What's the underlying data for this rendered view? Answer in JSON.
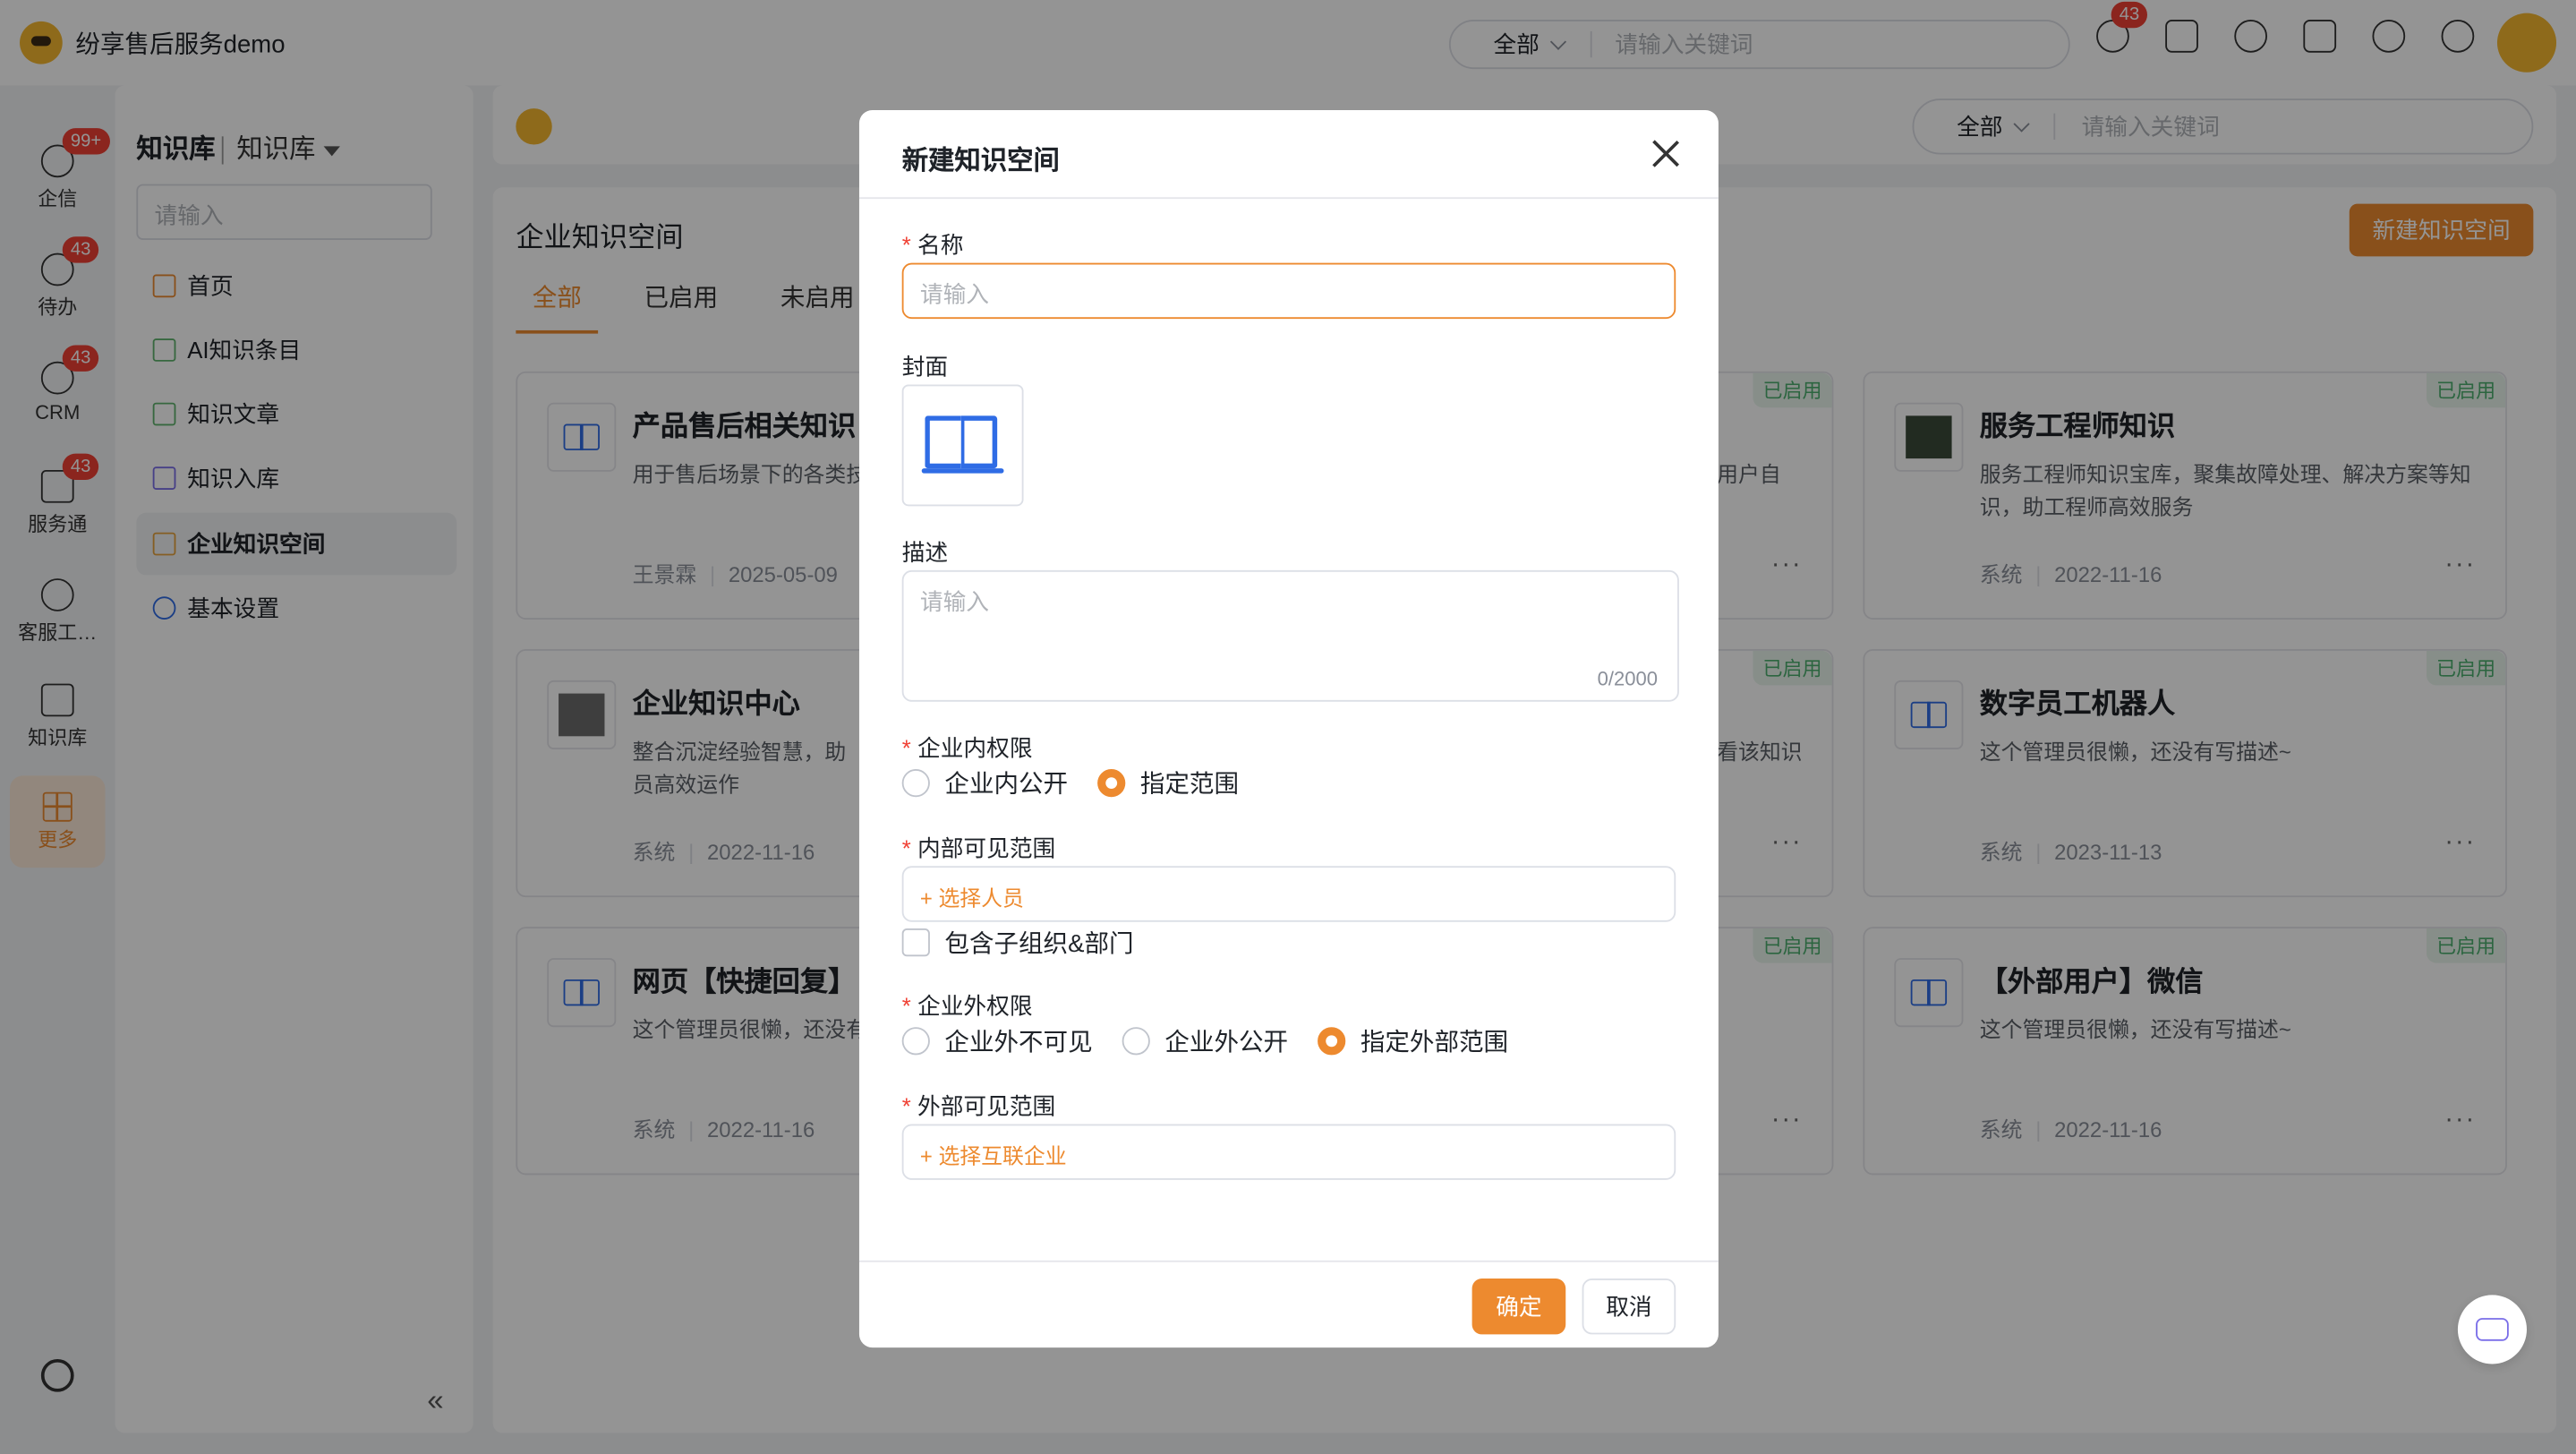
{
  "app": {
    "title": "纷享售后服务demo"
  },
  "top_search": {
    "scope": "全部",
    "placeholder": "请输入关键词"
  },
  "top_icons": {
    "notify_badge": "43"
  },
  "rail": {
    "items": [
      {
        "label": "企信",
        "badge": "99+"
      },
      {
        "label": "待办",
        "badge": "43"
      },
      {
        "label": "CRM",
        "badge": "43"
      },
      {
        "label": "服务通",
        "badge": "43"
      },
      {
        "label": "客服工…",
        "badge": ""
      },
      {
        "label": "知识库",
        "badge": ""
      }
    ],
    "more_label": "更多"
  },
  "sidebar": {
    "title": "知识库",
    "subtitle": "知识库",
    "search_placeholder": "请输入",
    "items": [
      {
        "label": "首页"
      },
      {
        "label": "AI知识条目"
      },
      {
        "label": "知识文章"
      },
      {
        "label": "知识入库"
      },
      {
        "label": "企业知识空间"
      },
      {
        "label": "基本设置"
      }
    ],
    "collapse_label": "«"
  },
  "main": {
    "search": {
      "scope": "全部",
      "placeholder": "请输入关键词"
    },
    "title": "企业知识空间",
    "new_button": "新建知识空间",
    "tabs": [
      {
        "label": "全部"
      },
      {
        "label": "已启用"
      },
      {
        "label": "未启用"
      }
    ],
    "cards": [
      {
        "title": "产品售后相关知识",
        "desc": "用于售后场景下的各类技",
        "author": "王景霖",
        "date": "2025-05-09",
        "tag": "已启用",
        "more": "···"
      },
      {
        "title": "",
        "desc": "用户自",
        "author": "",
        "date": "",
        "tag": "已启用",
        "more": "···"
      },
      {
        "title": "服务工程师知识",
        "desc": "服务工程师知识宝库，聚集故障处理、解决方案等知识，助工程师高效服务",
        "author": "系统",
        "date": "2022-11-16",
        "tag": "已启用",
        "more": "···"
      },
      {
        "title": "企业知识中心",
        "desc": "整合沉淀经验智慧，助员高效运作",
        "author": "系统",
        "date": "2022-11-16",
        "tag": "",
        "more": ""
      },
      {
        "title": "",
        "desc": "看该知识",
        "author": "",
        "date": "",
        "tag": "已启用",
        "more": "···"
      },
      {
        "title": "数字员工机器人",
        "desc": "这个管理员很懒，还没有写描述~",
        "author": "系统",
        "date": "2023-11-13",
        "tag": "已启用",
        "more": "···"
      },
      {
        "title": "网页【快捷回复】",
        "desc": "这个管理员很懒，还没有",
        "author": "系统",
        "date": "2022-11-16",
        "tag": "",
        "more": ""
      },
      {
        "title": "",
        "desc": "",
        "author": "",
        "date": "",
        "tag": "已启用",
        "more": "···"
      },
      {
        "title": "【外部用户】微信",
        "desc": "这个管理员很懒，还没有写描述~",
        "author": "系统",
        "date": "2022-11-16",
        "tag": "已启用",
        "more": "···"
      }
    ]
  },
  "modal": {
    "title": "新建知识空间",
    "name_label": "名称",
    "name_placeholder": "请输入",
    "cover_label": "封面",
    "desc_label": "描述",
    "desc_placeholder": "请输入",
    "desc_counter": "0/2000",
    "internal_perm_label": "企业内权限",
    "internal_options": [
      {
        "label": "企业内公开",
        "selected": false
      },
      {
        "label": "指定范围",
        "selected": true
      }
    ],
    "internal_scope_label": "内部可见范围",
    "select_people": "+ 选择人员",
    "include_sub_label": "包含子组织&部门",
    "external_perm_label": "企业外权限",
    "external_options": [
      {
        "label": "企业外不可见",
        "selected": false
      },
      {
        "label": "企业外公开",
        "selected": false
      },
      {
        "label": "指定外部范围",
        "selected": true
      }
    ],
    "external_scope_label": "外部可见范围",
    "select_company": "+ 选择互联企业",
    "ok_label": "确定",
    "cancel_label": "取消",
    "required_mark": "*"
  },
  "colors": {
    "accent": "#ed8a2f",
    "book_blue": "#2f6ce5",
    "badge_red": "#f04134",
    "tag_green": "#4caf6e"
  }
}
